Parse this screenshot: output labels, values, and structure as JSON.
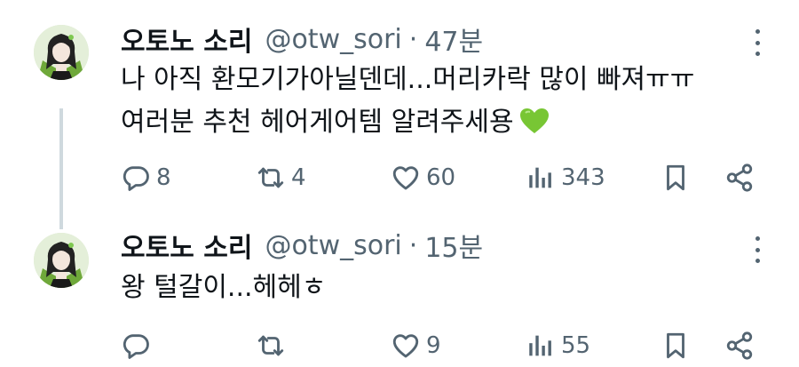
{
  "tweets": [
    {
      "display_name": "오토노 소리",
      "handle": "@otw_sori",
      "separator": "·",
      "time": "47분",
      "lines": [
        "나 아직 환모기가아닐덴데...머리카락 많이 빠져ㅠㅠ",
        "여러분 추천 헤어게어템 알려주세용"
      ],
      "emoji": "green-heart",
      "replies": "8",
      "retweets": "4",
      "likes": "60",
      "views": "343"
    },
    {
      "display_name": "오토노 소리",
      "handle": "@otw_sori",
      "separator": "·",
      "time": "15분",
      "lines": [
        "왕 털갈이...헤헤ㅎ"
      ],
      "replies": "",
      "retweets": "",
      "likes": "9",
      "views": "55"
    }
  ],
  "icons": {
    "reply": "speech-bubble-icon",
    "retweet": "retweet-arrows-icon",
    "like": "heart-outline-icon",
    "views": "bar-chart-icon",
    "bookmark": "bookmark-icon",
    "share": "share-nodes-icon",
    "more": "vertical-dots-icon"
  },
  "colors": {
    "text": "#0f1419",
    "secondary": "#536471",
    "thread_line": "#cfd9de",
    "emoji_heart": "#78c634"
  }
}
